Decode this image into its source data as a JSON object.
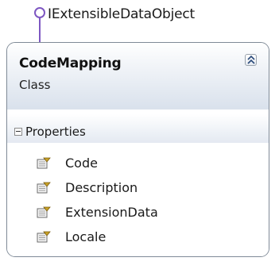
{
  "interface": {
    "name": "IExtensibleDataObject",
    "icon": "interface-lollipop-icon"
  },
  "class": {
    "name": "CodeMapping",
    "kind": "Class",
    "collapse_icon": "double-chevron-up-icon"
  },
  "compartment": {
    "title": "Properties",
    "expander_icon": "collapse-minus-icon",
    "items": [
      {
        "label": "Code",
        "icon": "property-icon"
      },
      {
        "label": "Description",
        "icon": "property-icon"
      },
      {
        "label": "ExtensionData",
        "icon": "property-icon"
      },
      {
        "label": "Locale",
        "icon": "property-icon"
      }
    ]
  },
  "colors": {
    "border": "#7f8a97",
    "lollipop": "#7e57c2",
    "header_gradient_end": "#d9e1ec"
  }
}
